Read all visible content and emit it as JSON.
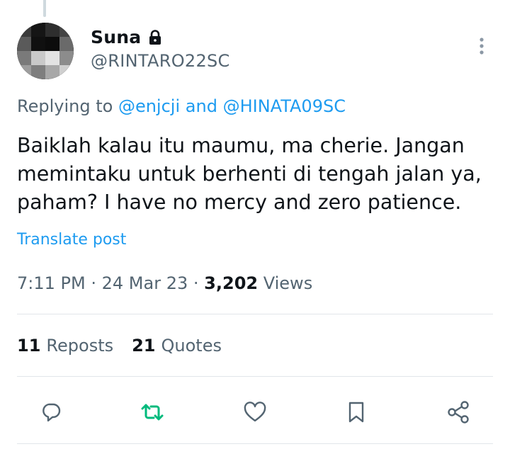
{
  "post": {
    "display_name": "Suna",
    "handle": "@RINTARO22SC",
    "reply_prefix": "Replying to",
    "reply_user_1": "@enjcji",
    "reply_and": "and",
    "reply_user_2": "@HINATA09SC",
    "text": "Baiklah kalau itu maumu, ma cherie. Jangan\nmemintaku untuk berhenti di tengah jalan ya,\npaham? I have no mercy and zero patience.",
    "translate_label": "Translate post",
    "time": "7:11 PM",
    "date": "24 Mar 23",
    "views_count": "3,202",
    "views_label": "Views",
    "separator": "·"
  },
  "stats": {
    "reposts_count": "11",
    "reposts_label": "Reposts",
    "quotes_count": "21",
    "quotes_label": "Quotes"
  },
  "colors": {
    "link": "#1d9bf0",
    "secondary_text": "#536471",
    "primary_text": "#0f1419",
    "repost_icon": "#00ba7c",
    "action_icon": "#536471"
  },
  "icons": {
    "protected": "lock-icon",
    "more": "more-vertical-icon",
    "reply": "reply-icon",
    "repost": "repost-icon",
    "like": "heart-icon",
    "bookmark": "bookmark-icon",
    "share": "share-icon"
  }
}
